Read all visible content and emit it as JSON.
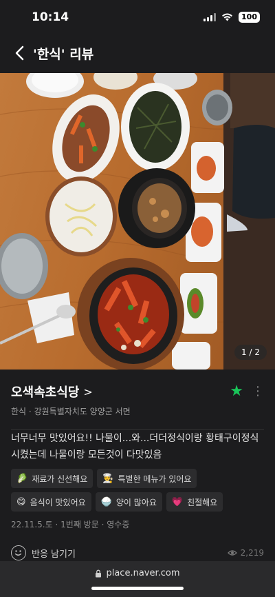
{
  "status_bar": {
    "time": "10:14",
    "battery": "100"
  },
  "nav": {
    "title": "'한식' 리뷰"
  },
  "photo": {
    "counter": "1 / 2"
  },
  "place": {
    "name": "오색속초식당",
    "chevron": ">",
    "category": "한식",
    "separator": "·",
    "location": "강원특별자치도 양양군 서면"
  },
  "review": {
    "text": "너무너무 맛있어요!! 나물이...와...더더정식이랑 황태구이정식 시켰는데 나물이랑 모든것이 다맛있음"
  },
  "tags": [
    {
      "emoji": "🥬",
      "label": "재료가 신선해요"
    },
    {
      "emoji": "👨‍🍳",
      "label": "특별한 메뉴가 있어요"
    },
    {
      "emoji": "😋",
      "label": "음식이 맛있어요"
    },
    {
      "emoji": "🍚",
      "label": "양이 많아요"
    },
    {
      "emoji": "💗",
      "label": "친절해요"
    }
  ],
  "visit": {
    "date": "22.11.5.토",
    "visit_count": "1번째 방문",
    "receipt": "영수증"
  },
  "reaction": {
    "label": "반응 남기기",
    "views": "2,219"
  },
  "browser": {
    "url": "place.naver.com"
  },
  "colors": {
    "accent": "#19c65a",
    "background": "#1c1c1e"
  }
}
